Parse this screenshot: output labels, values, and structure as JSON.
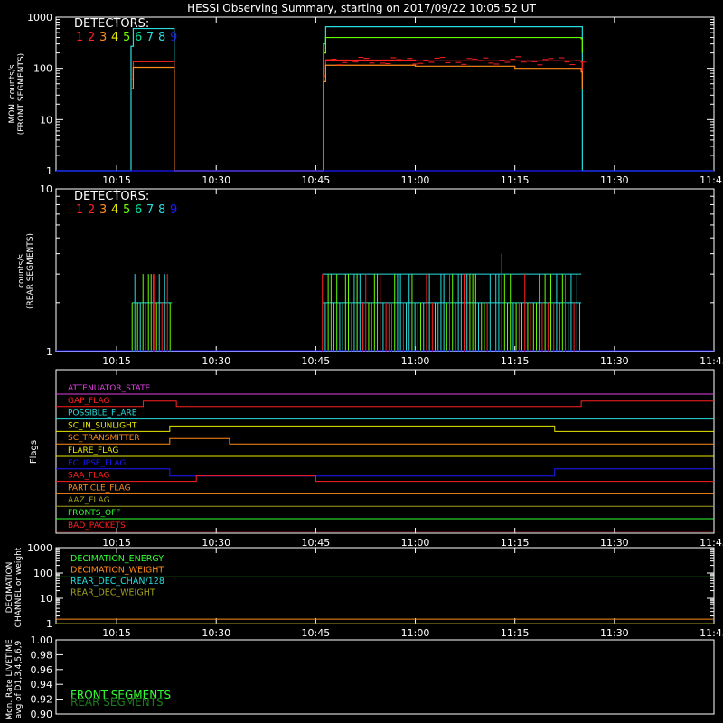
{
  "title": "HESSI Observing Summary, starting on 2017/09/22 10:05:52 UT",
  "time_ticks": [
    "10:15",
    "10:30",
    "10:45",
    "11:00",
    "11:15",
    "11:30",
    "11:45"
  ],
  "detector_colors": [
    "#ff2020",
    "#ff2020",
    "#ff8c1a",
    "#e8e800",
    "#66ff00",
    "#00e5a0",
    "#28dcdc",
    "#28dcdc",
    "#1a1aff"
  ],
  "chart_data": [
    {
      "type": "line",
      "panel": "front",
      "title": "DETECTORS:",
      "detector_labels": [
        "1",
        "2",
        "3",
        "4",
        "5",
        "6",
        "7",
        "8",
        "9"
      ],
      "ylabel": [
        "MON. counts/s",
        "(FRONT SEGMENTS)"
      ],
      "yscale": "log",
      "ylim": [
        1,
        1000
      ],
      "yticks": [
        "1",
        "10",
        "100",
        "1000"
      ],
      "xlim": [
        "10:05:52",
        "11:45:00"
      ],
      "series": [
        {
          "color": "#28dcdc",
          "x": [
            "10:05:52",
            "10:17:00",
            "10:17:10",
            "10:17:30",
            "10:23:30",
            "10:23:40",
            "10:46:00",
            "10:46:10",
            "10:46:30",
            "11:25:00",
            "11:25:10",
            "11:45:00"
          ],
          "y": [
            1,
            1,
            270,
            600,
            600,
            1,
            1,
            300,
            650,
            650,
            1,
            1
          ]
        },
        {
          "color": "#66ff00",
          "x": [
            "10:46:10",
            "10:46:30",
            "11:25:00",
            "11:25:10"
          ],
          "y": [
            200,
            400,
            380,
            200
          ]
        },
        {
          "color": "#ff2020",
          "x": [
            "10:17:10",
            "10:17:30",
            "10:23:30",
            "10:23:40",
            "10:46:10",
            "10:46:30",
            "11:00:00",
            "11:15:00",
            "11:25:00",
            "11:25:10"
          ],
          "y": [
            60,
            135,
            135,
            1,
            70,
            145,
            140,
            140,
            135,
            60
          ]
        },
        {
          "color": "#ff8c1a",
          "x": [
            "10:17:10",
            "10:17:30",
            "10:23:30",
            "10:23:40",
            "10:46:10",
            "10:46:30",
            "11:00:00",
            "11:15:00",
            "11:25:00",
            "11:25:10"
          ],
          "y": [
            40,
            105,
            105,
            1,
            55,
            115,
            110,
            100,
            85,
            40
          ]
        },
        {
          "color": "#1a1aff",
          "x": [
            "10:05:52",
            "11:45:00"
          ],
          "y": [
            1,
            1
          ]
        }
      ]
    },
    {
      "type": "line",
      "panel": "rear",
      "title": "DETECTORS:",
      "detector_labels": [
        "1",
        "2",
        "3",
        "4",
        "5",
        "6",
        "7",
        "8",
        "9"
      ],
      "ylabel": [
        "counts/s",
        "(REAR SEGMENTS)"
      ],
      "yscale": "log",
      "ylim": [
        1,
        10
      ],
      "yticks": [
        "1",
        "10"
      ],
      "xlim": [
        "10:05:52",
        "11:45:00"
      ],
      "series": [
        {
          "color": "#28dcdc",
          "x": [
            "10:17:20",
            "10:23:20",
            "10:46:00",
            "11:25:00"
          ],
          "y": [
            2,
            2,
            3,
            3
          ]
        },
        {
          "color": "#66ff00",
          "x": [
            "10:17:20",
            "10:23:20",
            "10:46:00",
            "11:25:00"
          ],
          "y": [
            2,
            2,
            2,
            2
          ]
        },
        {
          "color": "#ff2020",
          "x": [
            "10:20:30",
            "11:13:00"
          ],
          "y": [
            3,
            4
          ]
        },
        {
          "color": "#1a1aff",
          "x": [
            "10:05:52",
            "11:45:00"
          ],
          "y": [
            1,
            1
          ]
        }
      ]
    },
    {
      "type": "line",
      "panel": "flags",
      "ylabel": "Flags",
      "flags": [
        {
          "label": "ATTENUATOR_STATE",
          "color": "#e040e0"
        },
        {
          "label": "GAP_FLAG",
          "color": "#ff2020"
        },
        {
          "label": "POSSIBLE_FLARE",
          "color": "#28dcdc"
        },
        {
          "label": "SC_IN_SUNLIGHT",
          "color": "#e8e800"
        },
        {
          "label": "SC_TRANSMITTER",
          "color": "#ff8c1a"
        },
        {
          "label": "FLARE_FLAG",
          "color": "#e8e800"
        },
        {
          "label": "ECLIPSE_FLAG",
          "color": "#1a1aff"
        },
        {
          "label": "SAA_FLAG",
          "color": "#ff2020"
        },
        {
          "label": "PARTICLE_FLAG",
          "color": "#ff8c1a"
        },
        {
          "label": "AAZ_FLAG",
          "color": "#a0a020"
        },
        {
          "label": "FRONTS_OFF",
          "color": "#33ff33"
        },
        {
          "label": "BAD_PACKETS",
          "color": "#ff2020"
        }
      ]
    },
    {
      "type": "line",
      "panel": "decimation",
      "ylabel": [
        "DECIMATION",
        "CHANNEL or weight"
      ],
      "yscale": "log",
      "ylim": [
        1,
        1000
      ],
      "yticks": [
        "1",
        "10",
        "100",
        "1000"
      ],
      "legend": [
        {
          "label": "DECIMATION_ENERGY",
          "color": "#33ff33"
        },
        {
          "label": "DECIMATION_WEIGHT",
          "color": "#ff8c1a"
        },
        {
          "label": "REAR_DEC_CHAN/128",
          "color": "#28dcdc"
        },
        {
          "label": "REAR_DEC_WEIGHT",
          "color": "#a0a020"
        }
      ],
      "series": [
        {
          "label": "DECIMATION_ENERGY",
          "y": 70
        },
        {
          "label": "DECIMATION_WEIGHT",
          "y": 1.5
        },
        {
          "label": "REAR_DEC_WEIGHT",
          "y": 1
        }
      ]
    },
    {
      "type": "line",
      "panel": "livetime",
      "ylabel": [
        "Mon. Rate LIVETIME",
        "avg of D1,3,4,5,6,9"
      ],
      "ylim": [
        0.9,
        1.0
      ],
      "yticks": [
        "0.90",
        "0.92",
        "0.94",
        "0.96",
        "0.98",
        "1.00"
      ],
      "legend": [
        {
          "label": "FRONT SEGMENTS",
          "color": "#33ff33"
        },
        {
          "label": "REAR SEGMENTS",
          "color": "#1d7a1d"
        }
      ]
    }
  ]
}
